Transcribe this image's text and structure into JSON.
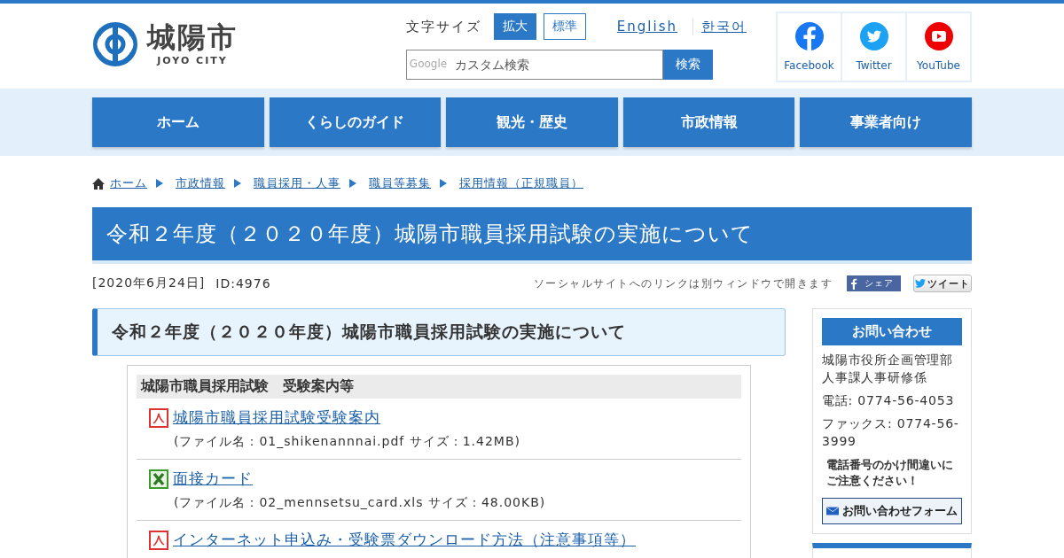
{
  "logo": {
    "name": "城陽市",
    "subtitle": "JOYO CITY"
  },
  "font_size": {
    "label": "文字サイズ",
    "options": [
      {
        "label": "拡大",
        "selected": true
      },
      {
        "label": "標準",
        "selected": false
      }
    ]
  },
  "languages": [
    "English",
    "한국어"
  ],
  "search": {
    "brand": "Google",
    "placeholder": "カスタム検索",
    "button": "検索"
  },
  "social": [
    {
      "kind": "facebook",
      "label": "Facebook"
    },
    {
      "kind": "twitter",
      "label": "Twitter"
    },
    {
      "kind": "youtube",
      "label": "YouTube"
    }
  ],
  "nav": [
    "ホーム",
    "くらしのガイド",
    "観光・歴史",
    "市政情報",
    "事業者向け"
  ],
  "breadcrumb": [
    "ホーム",
    "市政情報",
    "職員採用・人事",
    "職員等募集",
    "採用情報（正規職員）"
  ],
  "page_title": "令和２年度（２０２０年度）城陽市職員採用試験の実施について",
  "meta": {
    "date": "[2020年6月24日]",
    "id": "ID:4976",
    "social_note": "ソーシャルサイトへのリンクは別ウィンドウで開きます",
    "share": "シェア",
    "tweet": "ツイート"
  },
  "section_heading": "令和２年度（２０２０年度）城陽市職員採用試験の実施について",
  "files": {
    "heading": "城陽市職員採用試験　受験案内等",
    "items": [
      {
        "kind": "pdf",
        "title": "城陽市職員採用試験受験案内",
        "info": "(ファイル名：01_shikenannnai.pdf サイズ：1.42MB)"
      },
      {
        "kind": "xls",
        "title": "面接カード",
        "info": "(ファイル名：02_mennsetsu_card.xls サイズ：48.00KB)"
      },
      {
        "kind": "pdf",
        "title": "インターネット申込み・受験票ダウンロード方法（注意事項等）"
      }
    ]
  },
  "contact": {
    "heading": "お問い合わせ",
    "lines": [
      "城陽市役所企画管理部人事課人事研修係",
      "電話: 0774-56-4053",
      "ファックス: 0774-56-3999"
    ],
    "warning": "電話番号のかけ間違いにご注意ください！",
    "form_button": "お問い合わせフォーム"
  }
}
